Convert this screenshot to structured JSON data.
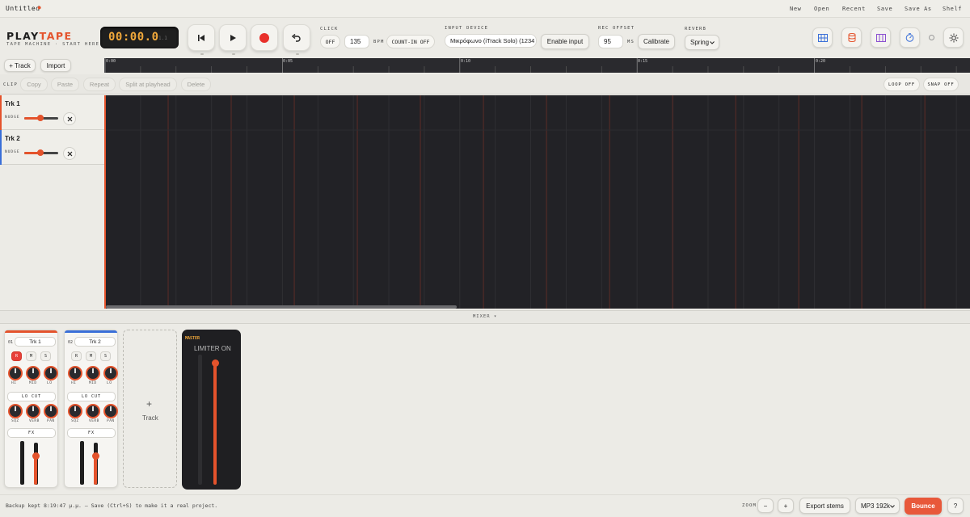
{
  "menubar": {
    "doc_title": "Untitled",
    "dirty_marker": "●",
    "items": [
      "New",
      "Open",
      "Recent",
      "Save",
      "Save As",
      "Shelf"
    ]
  },
  "brand": {
    "play": "PLAY",
    "tape": "TAPE",
    "tagline": "TAPE MACHINE · START HERE"
  },
  "transport": {
    "time": "00:00.0",
    "bar_beat": "1.1"
  },
  "click": {
    "label": "CLICK",
    "toggle": "OFF",
    "bpm": "135",
    "bpm_unit": "BPM",
    "count_in": "COUNT-IN OFF"
  },
  "input": {
    "label": "INPUT DEVICE",
    "device": "Μικρόφωνο (iTrack Solo) (1234",
    "enable": "Enable input"
  },
  "rec_offset": {
    "label": "REC OFFSET",
    "value": "95",
    "unit": "MS",
    "calibrate": "Calibrate"
  },
  "reverb": {
    "label": "REVERB",
    "value": "Spring"
  },
  "track_toolbar": {
    "add_track": "+ Track",
    "import": "Import"
  },
  "ruler": {
    "ticks": [
      "0:00",
      "0:05",
      "0:10",
      "0:15",
      "0:20"
    ]
  },
  "clip_bar": {
    "label": "CLIP",
    "buttons": [
      "Copy",
      "Paste",
      "Repeat",
      "Split at playhead",
      "Delete"
    ],
    "loop": "LOOP OFF",
    "snap": "SNAP OFF"
  },
  "tracks": [
    {
      "name": "Trk 1",
      "nudge": "NUDGE",
      "color": "#e4532c"
    },
    {
      "name": "Trk 2",
      "nudge": "NUDGE",
      "color": "#3a6fd8"
    }
  ],
  "mixer": {
    "label": "MIXER ▾",
    "channels": [
      {
        "num": "01",
        "name": "Trk 1",
        "r": "R",
        "m": "M",
        "s": "S",
        "k1": "HI",
        "k2": "MID",
        "k3": "LO",
        "locut": "LO CUT",
        "k4": "SQZ",
        "k5": "VERB",
        "k6": "PAN",
        "fx": "FX",
        "color": "#e4532c",
        "armed": true
      },
      {
        "num": "02",
        "name": "Trk 2",
        "r": "R",
        "m": "M",
        "s": "S",
        "k1": "HI",
        "k2": "MID",
        "k3": "LO",
        "locut": "LO CUT",
        "k4": "SQZ",
        "k5": "VERB",
        "k6": "PAN",
        "fx": "FX",
        "color": "#3a6fd8",
        "armed": false
      }
    ],
    "add_plus": "+",
    "add_label": "Track",
    "master": {
      "label": "MASTER",
      "limiter": "LIMITER ON"
    }
  },
  "status": {
    "text": "Backup kept 8:19:47 μ.μ. — Save (Ctrl+S) to make it a real project.",
    "zoom": "ZOOM",
    "zoom_out": "−",
    "zoom_in": "+",
    "export": "Export stems",
    "format": "MP3 192k",
    "bounce": "Bounce",
    "help": "?"
  },
  "icons": [
    "grid-blue-icon",
    "cylinder-orange-icon",
    "columns-purple-icon",
    "timer-blue-icon",
    "small-circle-icon",
    "sun-gear-icon"
  ]
}
